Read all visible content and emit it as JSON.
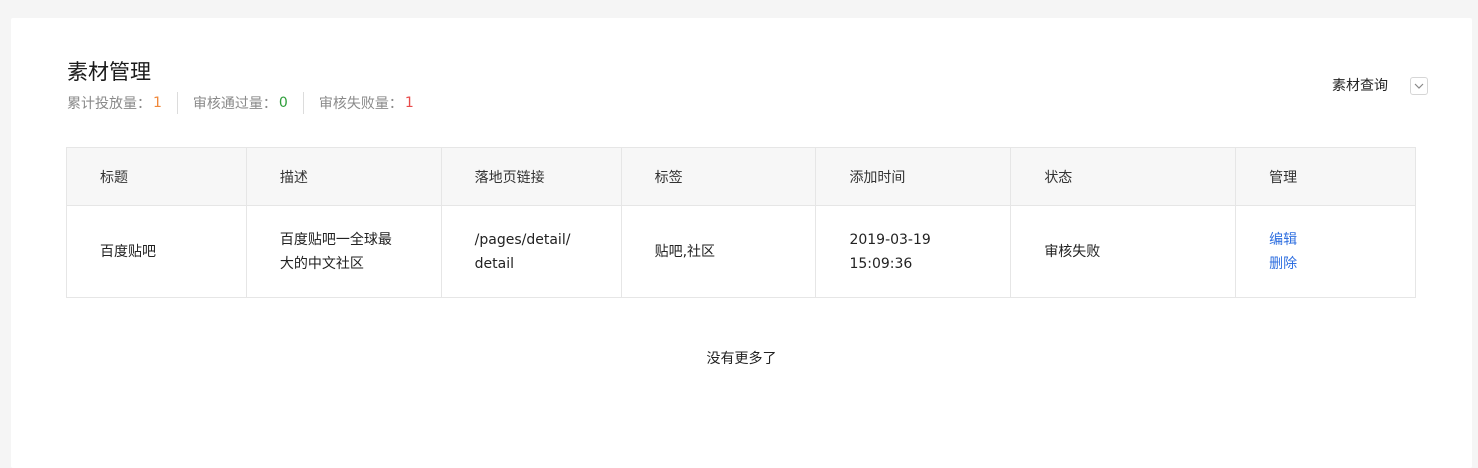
{
  "header": {
    "title": "素材管理",
    "stats": [
      {
        "label": "累计投放量：",
        "value": "1"
      },
      {
        "label": "审核通过量：",
        "value": "0"
      },
      {
        "label": "审核失败量：",
        "value": "1"
      }
    ],
    "query_label": "素材查询"
  },
  "table": {
    "columns": [
      "标题",
      "描述",
      "落地页链接",
      "标签",
      "添加时间",
      "状态",
      "管理"
    ],
    "rows": [
      {
        "title": "百度贴吧",
        "description_line1": "百度贴吧一全球最",
        "description_line2": "大的中文社区",
        "link_line1": "/pages/detail/",
        "link_line2": "detail",
        "tags": "贴吧,社区",
        "date": "2019-03-19",
        "time": "15:09:36",
        "status": "审核失败",
        "edit_label": "编辑",
        "delete_label": "删除"
      }
    ]
  },
  "footer": {
    "no_more": "没有更多了"
  },
  "colors": {
    "accent_link": "#2f6fe0",
    "status_fail": "#e84b4b",
    "stat_total": "#f0883a",
    "stat_pass": "#2e9e3a",
    "stat_fail": "#e84b4b"
  }
}
